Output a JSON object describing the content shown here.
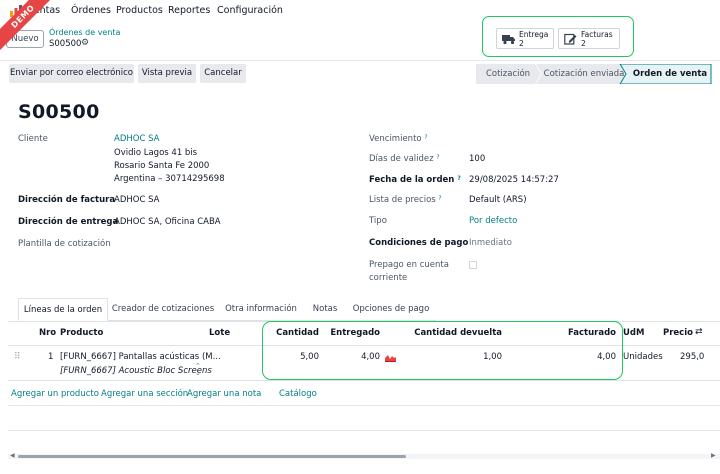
{
  "nav": {
    "app_name": "Ventas",
    "items": [
      "Órdenes",
      "Productos",
      "Reportes",
      "Configuración"
    ],
    "demo_badge": "DEMO"
  },
  "control": {
    "new_button": "Nuevo",
    "breadcrumb": "Órdenes de venta",
    "record_name": "S00500"
  },
  "smart_buttons": [
    {
      "label": "Entrega",
      "count": "2",
      "icon": "truck-icon"
    },
    {
      "label": "Facturas",
      "count": "2",
      "icon": "invoice-edit-icon"
    }
  ],
  "actions": [
    "Enviar por correo electrónico",
    "Vista previa",
    "Cancelar"
  ],
  "status_steps": [
    {
      "label": "Cotización",
      "active": false
    },
    {
      "label": "Cotización enviada",
      "active": false
    },
    {
      "label": "Orden de venta",
      "active": true
    }
  ],
  "record": {
    "title": "S00500",
    "left": {
      "cliente_label": "Cliente",
      "cliente_name": "ADHOC SA",
      "address1": "Ovidio Lagos 41 bis",
      "address2": "Rosario Santa Fe 2000",
      "address3": "Argentina – 30714295698",
      "factura_label": "Dirección de factura",
      "factura_value": "ADHOC SA",
      "entrega_label": "Dirección de entrega",
      "entrega_value": "ADHOC SA, Oficina CABA",
      "plantilla_label": "Plantilla de cotización"
    },
    "right": {
      "vencimiento_label": "Vencimiento",
      "validez_label": "Días de validez",
      "validez_value": "100",
      "fecha_label": "Fecha de la orden",
      "fecha_value": "29/08/2025 14:57:27",
      "precios_label": "Lista de precios",
      "precios_value": "Default (ARS)",
      "tipo_label": "Tipo",
      "tipo_value": "Por defecto",
      "pago_label": "Condiciones de pago",
      "pago_value": "Inmediato",
      "prepago_label_1": "Prepago en cuenta",
      "prepago_label_2": "corriente"
    }
  },
  "tabs": [
    {
      "label": "Líneas de la orden",
      "active": true
    },
    {
      "label": "Creador de cotizaciones",
      "active": false
    },
    {
      "label": "Otra información",
      "active": false
    },
    {
      "label": "Notas",
      "active": false
    },
    {
      "label": "Opciones de pago",
      "active": false
    }
  ],
  "table": {
    "headers": {
      "nro": "Nro",
      "producto": "Producto",
      "lote": "Lote",
      "cantidad": "Cantidad",
      "entregado": "Entregado",
      "devuelta": "Cantidad devuelta",
      "facturado": "Facturado",
      "udm": "UdM",
      "precio": "Precio"
    },
    "rows": [
      {
        "nro": "1",
        "producto": "[FURN_6667] Pantallas acústicas (M...",
        "descripcion": "[FURN_6667] Acoustic Bloc Screens",
        "cantidad": "5,00",
        "entregado": "4,00",
        "devuelta": "1,00",
        "facturado": "4,00",
        "udm": "Unidades",
        "precio": "295,0"
      }
    ],
    "add_links": [
      "Agregar un producto",
      "Agregar una sección",
      "Agregar una nota",
      "Catálogo"
    ]
  }
}
